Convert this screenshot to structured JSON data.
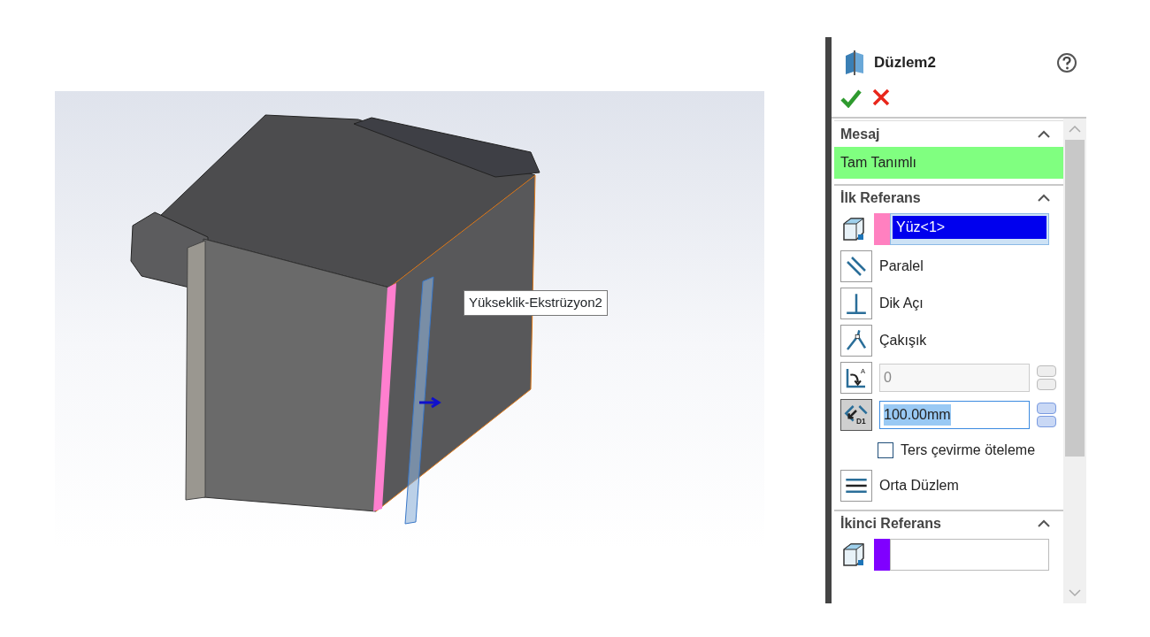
{
  "viewport": {
    "tooltip": "Yükseklik-Ekstrüzyon2"
  },
  "panel": {
    "title": "Düzlem2",
    "sections": [
      {
        "title": "Mesaj",
        "expanded": true,
        "kind": "message",
        "message": "Tam Tanımlı",
        "color": "#80ff80"
      },
      {
        "title": "İlk Referans",
        "expanded": true,
        "kind": "reference",
        "selection": "Yüz<1>",
        "color": "#ff80c0",
        "items": [
          {
            "kind": "toggle",
            "label": "Paralel",
            "selected": false
          },
          {
            "kind": "toggle",
            "label": "Dik Açı",
            "selected": false
          },
          {
            "kind": "toggle",
            "label": "Çakışık",
            "selected": false
          },
          {
            "kind": "spin",
            "icon_text": "A",
            "value": "0",
            "selected": false,
            "disabled": true
          },
          {
            "kind": "spin",
            "icon_text": "D1",
            "value": "100.00mm",
            "selected": true,
            "disabled": false
          },
          {
            "kind": "checkbox",
            "label": "Ters çevirme öteleme",
            "checked": false
          },
          {
            "kind": "toggle",
            "label": "Orta Düzlem",
            "selected": false
          }
        ]
      },
      {
        "title": "İkinci Referans",
        "expanded": true,
        "kind": "reference",
        "color": "#8000ff"
      }
    ]
  }
}
